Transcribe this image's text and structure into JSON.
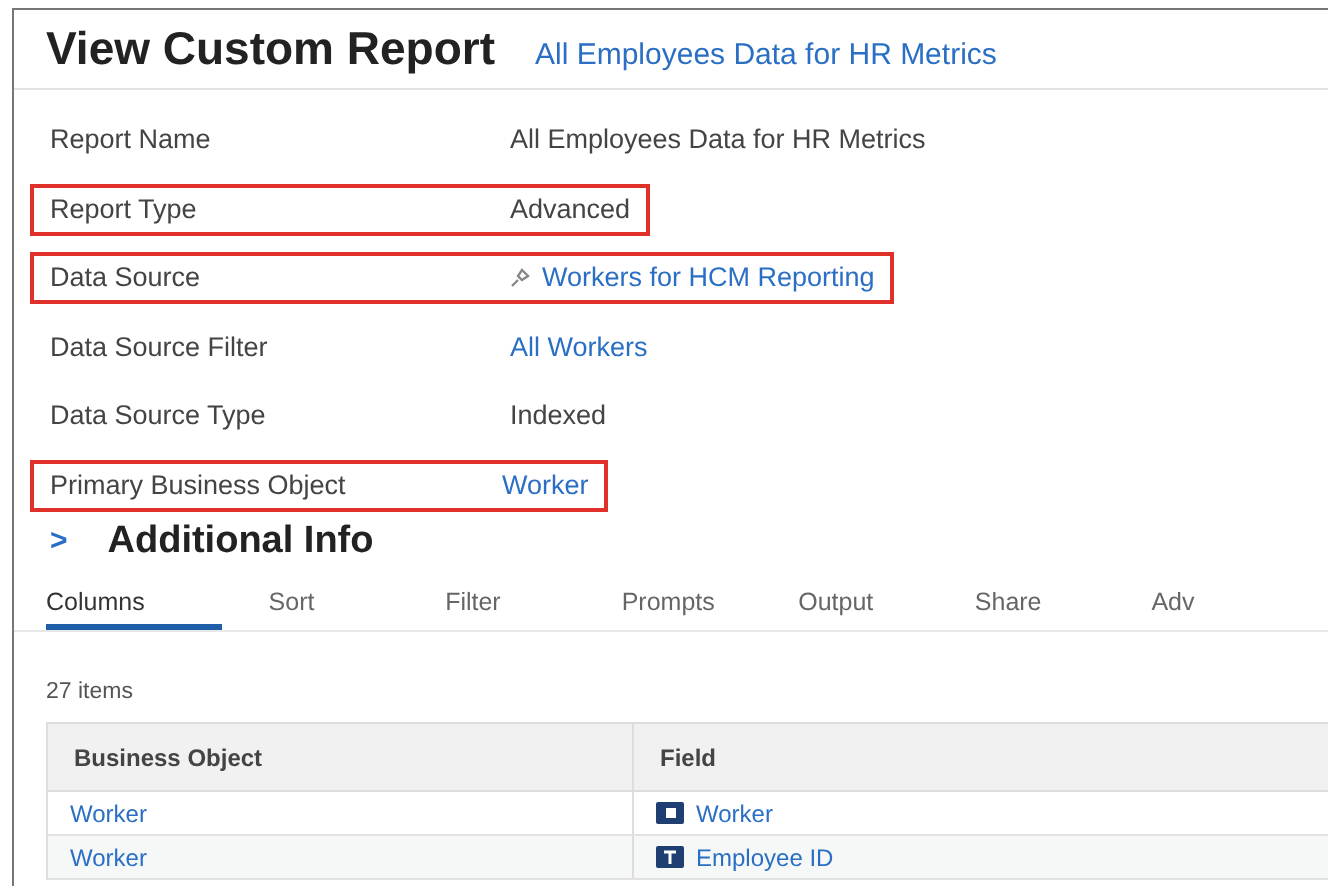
{
  "title": "View Custom Report",
  "subtitle": "All Employees Data for HR Metrics",
  "fields": [
    {
      "label": "Report Name",
      "value": "All Employees Data for HR Metrics",
      "kind": "text",
      "highlighted": false
    },
    {
      "label": "Report Type",
      "value": "Advanced",
      "kind": "text",
      "highlighted": true
    },
    {
      "label": "Data Source",
      "value": "Workers for HCM Reporting",
      "kind": "pinned-link",
      "highlighted": true
    },
    {
      "label": "Data Source Filter",
      "value": "All Workers",
      "kind": "link",
      "highlighted": false
    },
    {
      "label": "Data Source Type",
      "value": "Indexed",
      "kind": "text",
      "highlighted": false
    },
    {
      "label": "Primary Business Object",
      "value": "Worker",
      "kind": "link",
      "highlighted": true
    }
  ],
  "section": {
    "toggle": ">",
    "title": "Additional Info"
  },
  "tabs": [
    {
      "label": "Columns",
      "selected": true
    },
    {
      "label": "Sort",
      "selected": false
    },
    {
      "label": "Filter",
      "selected": false
    },
    {
      "label": "Prompts",
      "selected": false
    },
    {
      "label": "Output",
      "selected": false
    },
    {
      "label": "Share",
      "selected": false
    },
    {
      "label": "Adv",
      "selected": false
    }
  ],
  "item_count": "27 items",
  "table": {
    "columns": [
      "Business Object",
      "Field"
    ],
    "rows": [
      {
        "object": "Worker",
        "field": "Worker",
        "kind": "instance"
      },
      {
        "object": "Worker",
        "field": "Employee ID",
        "kind": "text"
      }
    ]
  }
}
